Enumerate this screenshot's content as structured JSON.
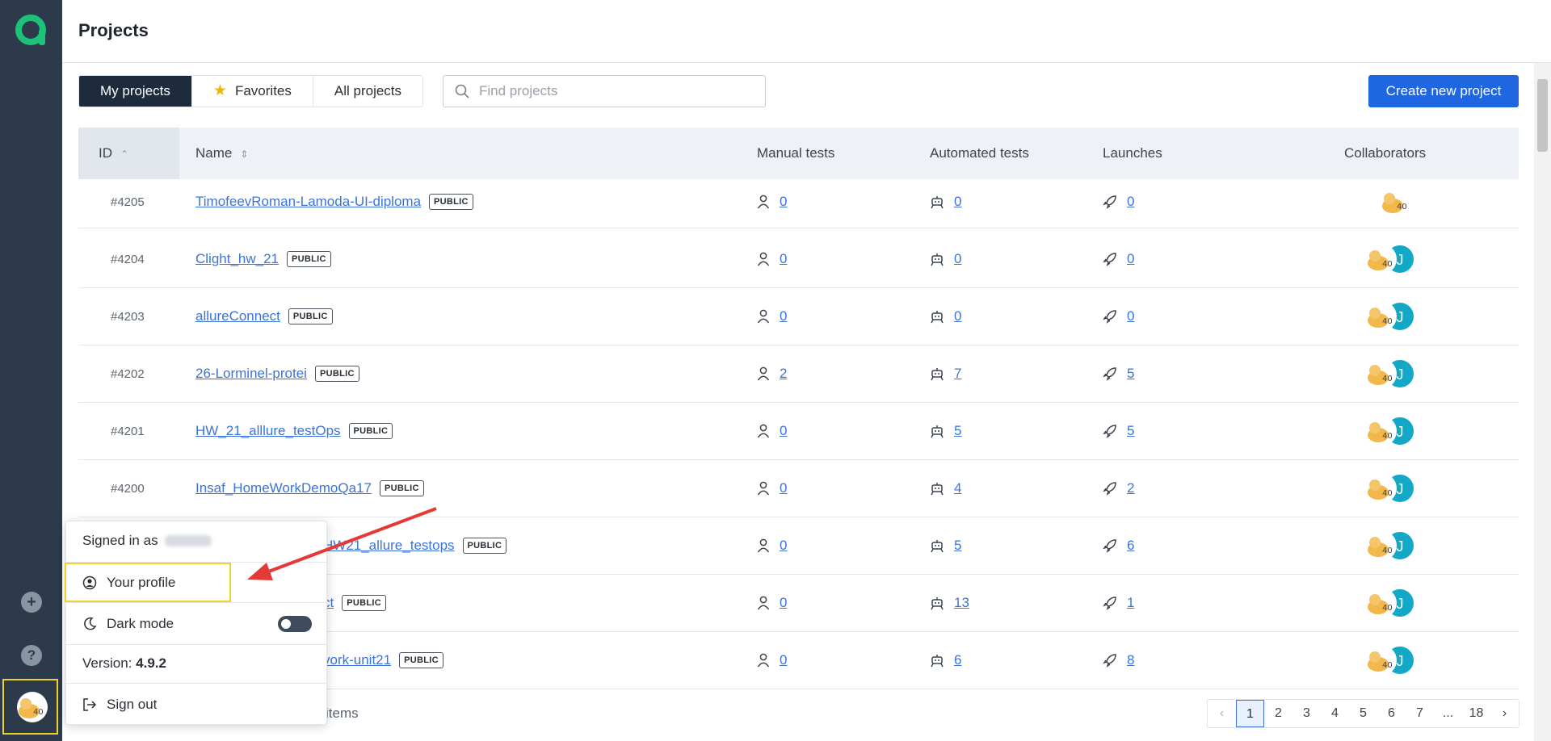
{
  "header": {
    "title": "Projects"
  },
  "tabs": [
    {
      "label": "My projects",
      "active": true
    },
    {
      "label": "Favorites",
      "icon": "star-icon"
    },
    {
      "label": "All projects"
    }
  ],
  "search": {
    "placeholder": "Find projects",
    "value": ""
  },
  "create_button": "Create new project",
  "table": {
    "columns": [
      "ID",
      "Name",
      "Manual tests",
      "Automated tests",
      "Launches",
      "Collaborators"
    ],
    "rows": [
      {
        "id": "#4205",
        "name": "TimofeevRoman-Lamoda-UI-diploma",
        "badge": "PUBLIC",
        "manual": "0",
        "automated": "0",
        "launches": "0",
        "collaborators": [
          "cat-avatar"
        ]
      },
      {
        "id": "#4204",
        "name": "Clight_hw_21",
        "badge": "PUBLIC",
        "manual": "0",
        "automated": "0",
        "launches": "0",
        "collaborators": [
          "cat-avatar",
          "J"
        ]
      },
      {
        "id": "#4203",
        "name": "allureConnect",
        "badge": "PUBLIC",
        "manual": "0",
        "automated": "0",
        "launches": "0",
        "collaborators": [
          "cat-avatar",
          "J"
        ]
      },
      {
        "id": "#4202",
        "name": "26-Lorminel-protei",
        "badge": "PUBLIC",
        "manual": "2",
        "automated": "7",
        "launches": "5",
        "collaborators": [
          "cat-avatar",
          "J"
        ]
      },
      {
        "id": "#4201",
        "name": "HW_21_alllure_testOps",
        "badge": "PUBLIC",
        "manual": "0",
        "automated": "5",
        "launches": "5",
        "collaborators": [
          "cat-avatar",
          "J"
        ]
      },
      {
        "id": "#4200",
        "name": "Insaf_HomeWorkDemoQa17",
        "badge": "PUBLIC",
        "manual": "0",
        "automated": "4",
        "launches": "2",
        "collaborators": [
          "cat-avatar",
          "J"
        ]
      },
      {
        "id": "",
        "name": "HW21_allure_testops",
        "badge": "PUBLIC",
        "manual": "0",
        "automated": "5",
        "launches": "6",
        "collaborators": [
          "cat-avatar",
          "J"
        ]
      },
      {
        "id": "",
        "name": "ct",
        "badge": "PUBLIC",
        "manual": "0",
        "automated": "13",
        "launches": "1",
        "collaborators": [
          "cat-avatar",
          "J"
        ]
      },
      {
        "id": "",
        "name": "vork-unit21",
        "badge": "PUBLIC",
        "manual": "0",
        "automated": "6",
        "launches": "8",
        "collaborators": [
          "cat-avatar",
          "J"
        ]
      }
    ]
  },
  "footer": {
    "items_text": "items",
    "pages": [
      "1",
      "2",
      "3",
      "4",
      "5",
      "6",
      "7",
      "...",
      "18"
    ],
    "current_page": "1"
  },
  "menu": {
    "signed_in": "Signed in as",
    "your_profile": "Your profile",
    "dark_mode": "Dark mode",
    "version_label": "Version:",
    "version": "4.9.2",
    "sign_out": "Sign out"
  },
  "sidebar": {
    "icons": [
      "add-icon",
      "help-icon",
      "user-avatar"
    ]
  },
  "colors": {
    "sidebar": "#2d3a4b",
    "accent": "#1f67e0",
    "link": "#3b73d8",
    "highlight": "#f1d22a",
    "annotation_arrow": "#e53935"
  }
}
